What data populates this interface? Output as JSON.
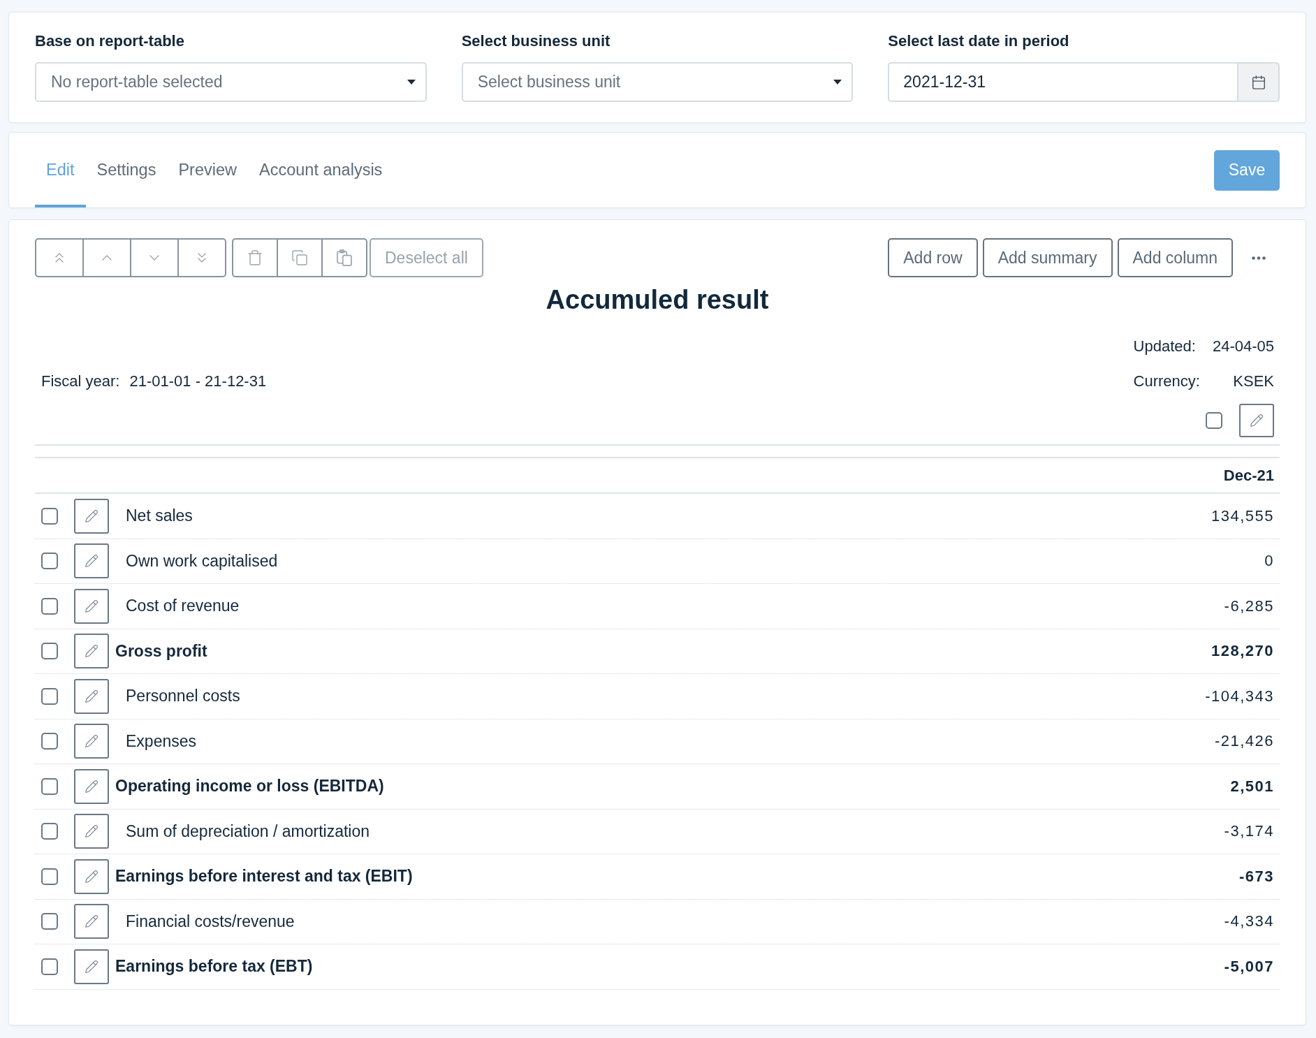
{
  "filters": [
    {
      "kind": "select",
      "label": "Base on report-table",
      "placeholder": "No report-table selected"
    },
    {
      "kind": "select",
      "label": "Select business unit",
      "placeholder": "Select business unit"
    },
    {
      "kind": "date",
      "label": "Select last date in period",
      "value": "2021-12-31"
    }
  ],
  "tabs": [
    {
      "label": "Edit",
      "selected": true
    },
    {
      "label": "Settings",
      "selected": false
    },
    {
      "label": "Preview",
      "selected": false
    },
    {
      "label": "Account analysis",
      "selected": false
    }
  ],
  "save_button": {
    "label": "Save"
  },
  "toolbar": {
    "move_buttons": [
      {
        "kind": "top",
        "disabled": true
      },
      {
        "kind": "up",
        "disabled": true
      },
      {
        "kind": "down",
        "disabled": true
      },
      {
        "kind": "bottom",
        "disabled": true
      }
    ],
    "edit_buttons": [
      {
        "kind": "delete",
        "disabled": true
      },
      {
        "kind": "copy",
        "disabled": true
      },
      {
        "kind": "paste",
        "disabled": true
      }
    ],
    "deselect_button": {
      "label": "Deselect all",
      "disabled": true
    },
    "add_buttons": [
      {
        "label": "Add row"
      },
      {
        "label": "Add summary"
      },
      {
        "label": "Add column"
      }
    ]
  },
  "report": {
    "title": "Accumuled result",
    "updated": {
      "label": "Updated:",
      "value": "24-04-05"
    },
    "fiscal_year": {
      "label": "Fiscal year:",
      "value": "21-01-01 - 21-12-31"
    },
    "currency": {
      "label": "Currency:",
      "value": "KSEK"
    }
  },
  "table": {
    "header_checkbox": {
      "checked": false
    },
    "columns": [
      "Dec-21"
    ],
    "rows": [
      {
        "kind": "account",
        "label": "Net sales",
        "value": "134,555",
        "checked": false
      },
      {
        "kind": "account",
        "label": "Own work capitalised",
        "value": "0",
        "checked": false
      },
      {
        "kind": "account",
        "label": "Cost of revenue",
        "value": "-6,285",
        "checked": false
      },
      {
        "kind": "total",
        "label": "Gross profit",
        "value": "128,270",
        "checked": false
      },
      {
        "kind": "account",
        "label": "Personnel costs",
        "value": "-104,343",
        "checked": false
      },
      {
        "kind": "account",
        "label": "Expenses",
        "value": "-21,426",
        "checked": false
      },
      {
        "kind": "total",
        "label": "Operating income or loss (EBITDA)",
        "value": "2,501",
        "checked": false
      },
      {
        "kind": "account",
        "label": "Sum of depreciation / amortization",
        "value": "-3,174",
        "checked": false
      },
      {
        "kind": "total",
        "label": "Earnings before interest and tax (EBIT)",
        "value": "-673",
        "checked": false
      },
      {
        "kind": "account",
        "label": "Financial costs/revenue",
        "value": "-4,334",
        "checked": false
      },
      {
        "kind": "total",
        "label": "Earnings before tax (EBT)",
        "value": "-5,007",
        "checked": false
      }
    ]
  }
}
